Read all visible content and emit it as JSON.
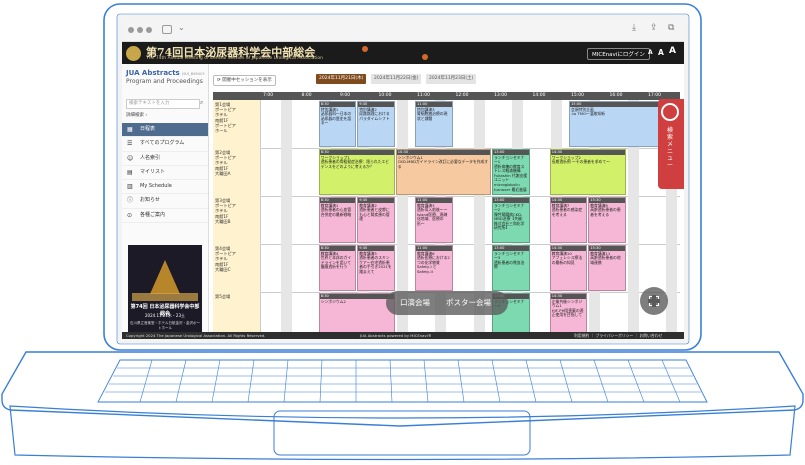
{
  "browser": {
    "url_icons": [
      "download-icon",
      "share-icon",
      "tabs-icon"
    ]
  },
  "banner": {
    "title": "第74回日本泌尿器科学会中部総会",
    "subtitle": "The 74th Annual Meeting of Central Section of Japanese Urological Association",
    "login_label": "MICEnaviにログイン",
    "font_sizes": [
      "A",
      "A",
      "A"
    ]
  },
  "sidebar": {
    "logo": "JUA Abstracts",
    "logo_tag": "JSUI_B96U03",
    "subtitle": "Program and Proceedings",
    "search_placeholder": "検索テキストを入力",
    "advanced_label": "詳細検索",
    "items": [
      {
        "label": "日程表",
        "icon": "calendar-icon"
      },
      {
        "label": "すべてのプログラム",
        "icon": "list-icon"
      },
      {
        "label": "人名索引",
        "icon": "person-icon"
      },
      {
        "label": "マイリスト",
        "icon": "bookmark-icon"
      },
      {
        "label": "My Schedule",
        "icon": "schedule-icon"
      },
      {
        "label": "お知らせ",
        "icon": "info-icon"
      },
      {
        "label": "各種ご案内",
        "icon": "guide-icon"
      }
    ],
    "poster": {
      "title": "第74回 日本泌尿器科学会中部総会",
      "date": "2024.11.21木・23土",
      "venue": "石川県立音楽堂・ホテル日航金沢・金沢ポートホール"
    }
  },
  "main": {
    "show_sessions_label": "開催中セッションを表示",
    "date_tabs": [
      "2024年11月21日(木)",
      "2024年11月22日(金)",
      "2024年11月23日(土)"
    ],
    "times": [
      "7:00",
      "8:00",
      "9:00",
      "10:00",
      "11:00",
      "12:00",
      "13:00",
      "14:00",
      "15:00",
      "16:00",
      "17:00",
      "18:00"
    ],
    "rooms": [
      {
        "name": "第1会場\nポートピア\nホテル\n南館1F\nポートピア\nホール"
      },
      {
        "name": "第2会場\nポートピア\nホテル\n南館1F\n大輪田A"
      },
      {
        "name": "第3会場\nポートピア\nホテル\n南館1F\n大輪田B"
      },
      {
        "name": "第4会場\nポートピア\nホテル\n南館1F\n大輪田C"
      },
      {
        "name": "第5会場"
      }
    ],
    "sessions": [
      {
        "row": 0,
        "start": "8:30",
        "end": "9:30",
        "color": "#b9d7f5",
        "time": "8:30",
        "text": "特別講演1\n泌尿器科〜日本の泌尿器の歴史を語る〜"
      },
      {
        "row": 0,
        "start": "9:30",
        "end": "10:30",
        "color": "#b9d7f5",
        "time": "9:30",
        "text": "特別講演2\n尿路病理における パラダイムシフト"
      },
      {
        "row": 0,
        "start": "11:00",
        "end": "12:00",
        "color": "#b9d7f5",
        "time": "11:00",
        "text": "特別講演3\n腎細胞癌治療の現状と課題"
      },
      {
        "row": 0,
        "start": "15:00",
        "end": "17:30",
        "color": "#b9d7f5",
        "time": "15:00",
        "text": "会頭特別企画\n-to TMG〜温故知新"
      },
      {
        "row": 1,
        "start": "8:30",
        "end": "10:30",
        "color": "#d3f06a",
        "time": "8:30",
        "text": "ワークショップ1\n透析患者の骨粗鬆症治療：限られたエビデンスをどのように考えるか？"
      },
      {
        "row": 1,
        "start": "10:30",
        "end": "13:00",
        "color": "#f6c9a0",
        "time": "10:30",
        "text": "シンポジウム1\nCKD-MBDガイドライン改訂に必要なデータを作成する"
      },
      {
        "row": 1,
        "start": "13:00",
        "end": "14:00",
        "color": "#7dd9b0",
        "time": "13:00",
        "text": "ランチョンセミナー1\n透析病棟の教育ストレス軽減機構 Fukashin 代謝支援ユニット microglobulin turnover 最近進展"
      },
      {
        "row": 1,
        "start": "14:30",
        "end": "16:30",
        "color": "#d3f06a",
        "time": "14:30",
        "text": "ワークショップ2\n長期透析例 〜その患者を求めて〜"
      },
      {
        "row": 2,
        "start": "8:30",
        "end": "9:30",
        "color": "#f6b6d5",
        "time": "8:30",
        "text": "教育講演1\n透析患者の心血管合併症の最新戦略"
      },
      {
        "row": 2,
        "start": "9:30",
        "end": "10:30",
        "color": "#f6b6d5",
        "time": "9:30",
        "text": "教育講演2\n透析患者と皮膚にも心と腎疾患の管理"
      },
      {
        "row": 2,
        "start": "11:00",
        "end": "12:00",
        "color": "#f6b6d5",
        "time": "11:00",
        "text": "教育講演3\n透析導入前後〜ーIsland医療、過疎化地域、医療の形〜"
      },
      {
        "row": 2,
        "start": "13:00",
        "end": "14:00",
        "color": "#7dd9b0",
        "time": "13:00",
        "text": "ランチョンセミナー2\n慢性腎臓病CKD-MBD治療【共催：株式会社三和化学研究所】"
      },
      {
        "row": 2,
        "start": "14:30",
        "end": "15:30",
        "color": "#f6b6d5",
        "time": "14:30",
        "text": "教育講演7\n透析患者の感染症を考える"
      },
      {
        "row": 2,
        "start": "15:30",
        "end": "16:30",
        "color": "#f6b6d5",
        "time": "15:30",
        "text": "教育講演8\n高齢透析患者の患者を考える"
      },
      {
        "row": 3,
        "start": "8:30",
        "end": "9:30",
        "color": "#f6b6d5",
        "time": "8:30",
        "text": "教育講演4\n世界と本邦のガイドラインを用いて腹膜透析を行う"
      },
      {
        "row": 3,
        "start": "9:30",
        "end": "10:30",
        "color": "#f6b6d5",
        "time": "9:30",
        "text": "教育講演5\n透析患者のスキンケア〜在宅透析患者の手引き2021を踏まえて"
      },
      {
        "row": 3,
        "start": "11:00",
        "end": "12:00",
        "color": "#f6b6d5",
        "time": "11:00",
        "text": "教育講演6\n透析医療における2つの化学物質Safety-I と Safety-II"
      },
      {
        "row": 3,
        "start": "13:00",
        "end": "14:00",
        "color": "#7dd9b0",
        "time": "13:00",
        "text": "ランチョンセミナー3\n透析患者の貧血治療"
      },
      {
        "row": 3,
        "start": "14:30",
        "end": "15:30",
        "color": "#f6b6d5",
        "time": "14:30",
        "text": "教育講演10\nアフェレシス療法の最新の知見"
      },
      {
        "row": 3,
        "start": "15:30",
        "end": "16:30",
        "color": "#f6b6d5",
        "time": "15:30",
        "text": "教育講演11\n高齢透析患者の地域連携"
      },
      {
        "row": 4,
        "start": "8:30",
        "end": "10:30",
        "color": "#f6b6d5",
        "time": "8:30",
        "text": "シンポジウム2"
      },
      {
        "row": 4,
        "start": "13:00",
        "end": "14:00",
        "color": "#7dd9b0",
        "time": "13:00",
        "text": "ランチョンセミナー4"
      },
      {
        "row": 4,
        "start": "14:30",
        "end": "15:30",
        "color": "#f6b6d5",
        "time": "14:30",
        "text": "企業共催シンポジウム1\nHIF-PH阻害薬の適正使用を目指して"
      }
    ]
  },
  "overlay": {
    "oral_label": "口演会場",
    "poster_label": "ポスター会場",
    "side_tab": "検索メニュー"
  },
  "footer": {
    "copyright": "Copyright 2024 The Japanese Urological Association. All Rights Reserved.",
    "powered": "JUA Abstracts powered by MICEnavi®",
    "links": "利用規約 ｜ プライバシーポリシー ｜ お問い合わせ"
  }
}
